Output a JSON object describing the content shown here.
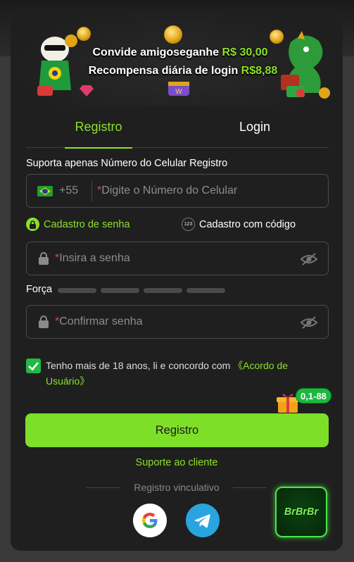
{
  "banner": {
    "line1_prefix": "Convide amigoseganhe ",
    "line1_amount": "R$ 30,00",
    "line2_prefix": "Recompensa diária de login ",
    "line2_amount": "R$8,88"
  },
  "tabs": [
    {
      "label": "Registro",
      "active": true
    },
    {
      "label": "Login",
      "active": false
    }
  ],
  "phone": {
    "hint": "Suporta apenas Número do Celular Registro",
    "dial_code": "+55",
    "required_mark": "*",
    "placeholder": "Digite o Número do Celular",
    "flag": "brazil-flag"
  },
  "methods": {
    "password": "Cadastro de senha",
    "code": "Cadastro com código",
    "code_icon_text": "123"
  },
  "password": {
    "required_mark": "*",
    "placeholder": "Insira a senha"
  },
  "strength": {
    "label": "Força",
    "levels": 4
  },
  "confirm": {
    "required_mark": "*",
    "placeholder": "Confirmar senha"
  },
  "agreement": {
    "checked": true,
    "text": "Tenho mais de 18 anos, li e concordo com ",
    "link": "《Acordo de Usuário》"
  },
  "promo_badge": "0,1-88",
  "register_button": "Registro",
  "support_link": "Suporte ao cliente",
  "linked_label": "Registro vinculativo",
  "social": [
    "google-icon",
    "telegram-icon"
  ],
  "floating_badge": "BrBrBr",
  "colors": {
    "accent": "#8be028",
    "button": "#7ddf27",
    "panel": "#1f1f1f",
    "checkbox": "#22b845",
    "required": "#e04646"
  }
}
